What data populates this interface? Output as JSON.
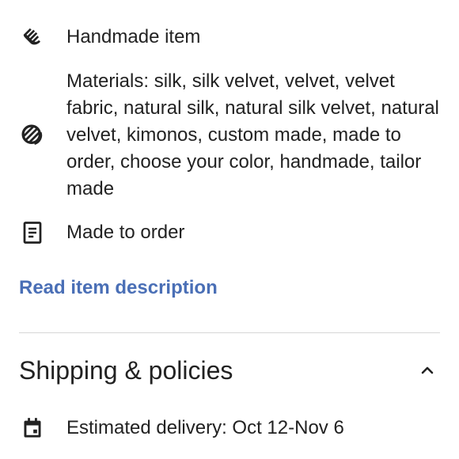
{
  "highlights": {
    "handmade": {
      "icon": "hand-icon",
      "label": "Handmade item"
    },
    "materials": {
      "icon": "fabric-swatch-icon",
      "label": "Materials: silk, silk velvet, velvet, velvet fabric, natural silk, natural silk velvet, natural velvet, kimonos, custom made, made to order, choose your color, handmade, tailor made"
    },
    "made_to_order": {
      "icon": "document-icon",
      "label": "Made to order"
    }
  },
  "description_link": "Read item description",
  "shipping": {
    "title": "Shipping & policies",
    "toggle_icon": "chevron-up-icon",
    "delivery": {
      "icon": "calendar-icon",
      "label": "Estimated delivery: Oct 12-Nov 6"
    }
  },
  "colors": {
    "text": "#222222",
    "link": "#4a6fb6",
    "divider": "#d6d6d6"
  }
}
